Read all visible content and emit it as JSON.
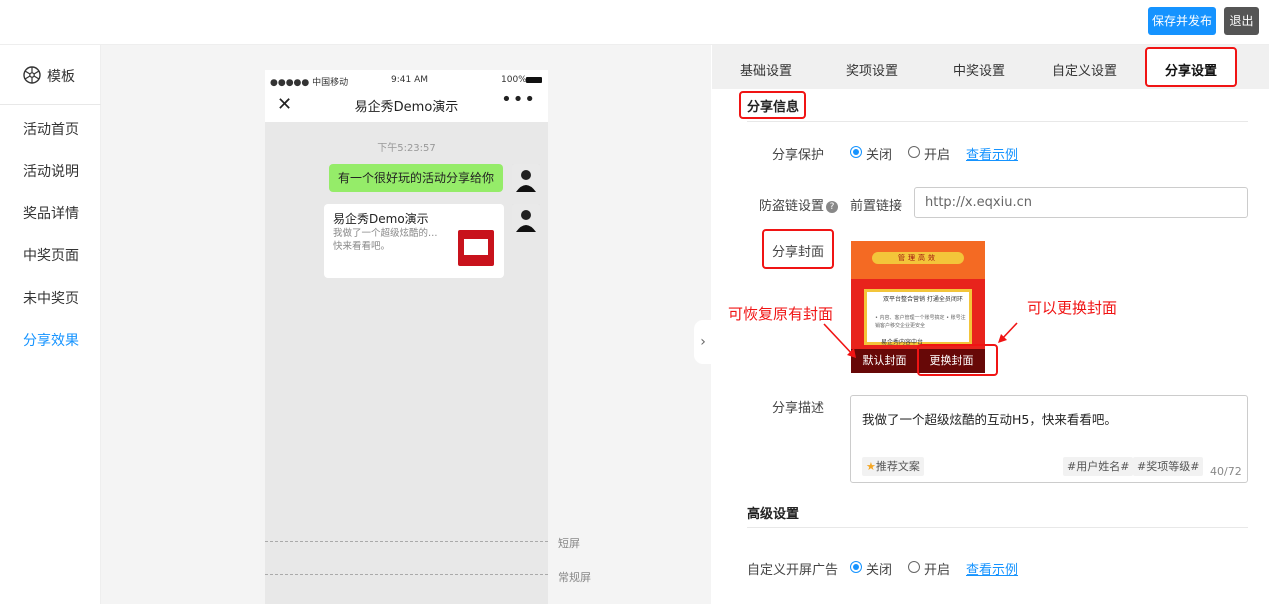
{
  "header": {
    "publish_label": "保存并发布",
    "exit_label": "退出"
  },
  "sidebar": {
    "title": "模板",
    "items": [
      {
        "label": "活动首页"
      },
      {
        "label": "活动说明"
      },
      {
        "label": "奖品详情"
      },
      {
        "label": "中奖页面"
      },
      {
        "label": "未中奖页"
      },
      {
        "label": "分享效果"
      }
    ]
  },
  "phone": {
    "carrier": "●●●●● 中国移动",
    "clock": "9:41 AM",
    "battery": "100%",
    "nav_title": "易企秀Demo演示",
    "chat_time": "下午5:23:57",
    "message": "有一个很好玩的活动分享给你",
    "card_title": "易企秀Demo演示",
    "card_desc": "我做了一个超级炫酷的…",
    "card_desc2": "快来看看吧。",
    "short_screen": "短屏",
    "normal_screen": "常规屏"
  },
  "tabs": [
    "基础设置",
    "奖项设置",
    "中奖设置",
    "自定义设置",
    "分享设置"
  ],
  "share_info": {
    "section_title": "分享信息",
    "protect_label": "分享保护",
    "off": "关闭",
    "on": "开启",
    "example": "查看示例",
    "antileech_label": "防盗链设置",
    "help": "?",
    "prefix_label": "前置链接",
    "url_placeholder": "http://x.eqxiu.cn",
    "cover_label": "分享封面",
    "cover_sign": "管理高效",
    "cover_text1": "双平台整合营销 打通全员闭环",
    "cover_text2": "• 内容、客户管理一个账号搞定 • 账号注销客户移交企业更安全",
    "cover_text3": "易企秀内容中台",
    "default_cover": "默认封面",
    "change_cover": "更换封面",
    "anno_restore": "可恢复原有封面",
    "anno_change": "可以更换封面",
    "desc_label": "分享描述",
    "desc_value": "我做了一个超级炫酷的互动H5，快来看看吧。",
    "recommend": "推荐文案",
    "tag_user": "#用户姓名#",
    "tag_level": "#奖项等级#",
    "counter": "40/72"
  },
  "advanced": {
    "section_title": "高级设置",
    "splash_label": "自定义开屏广告",
    "off": "关闭",
    "on": "开启",
    "example": "查看示例"
  },
  "colors": {
    "accent": "#1593ff",
    "annotation": "#f01414",
    "bubble": "#95ec69"
  }
}
